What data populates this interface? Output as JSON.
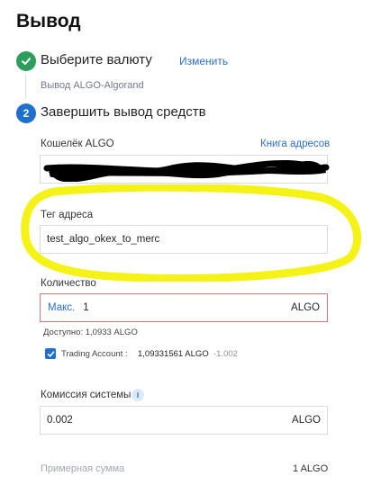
{
  "page": {
    "title": "Вывод"
  },
  "steps": {
    "step1": {
      "label": "Выберите валюту",
      "change": "Изменить",
      "detail": "Вывод ALGO-Algorand",
      "status_icon": "check-icon"
    },
    "step2": {
      "number": "2",
      "label": "Завершить вывод средств"
    }
  },
  "wallet": {
    "label": "Кошелёк ALGO",
    "address_book": "Книга адресов",
    "value_redacted": true
  },
  "tag": {
    "label": "Тег адреса",
    "value": "test_algo_okex_to_merc"
  },
  "quantity": {
    "label": "Количество",
    "max": "Макс.",
    "value": "1",
    "unit": "ALGO",
    "available": "Доступно:  1,0933 ALGO"
  },
  "trading_account": {
    "checked": true,
    "label": "Trading Account :",
    "value": "1,09331561 ALGO",
    "change": "-1.002"
  },
  "fee": {
    "label": "Комиссия системы",
    "info": "i",
    "value": "0.002",
    "unit": "ALGO"
  },
  "approx": {
    "label": "Примерная сумма",
    "value": "1 ALGO"
  },
  "colors": {
    "accent": "#2a6fd4",
    "success": "#2c9e5b",
    "error_border": "#e57373",
    "highlight": "#f5f218",
    "redaction": "#000000"
  }
}
